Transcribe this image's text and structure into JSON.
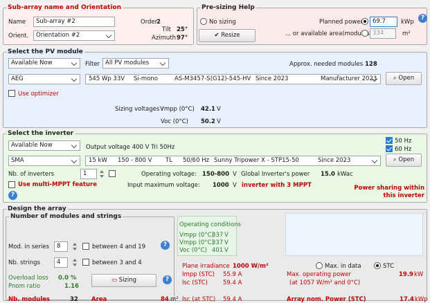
{
  "subarray": {
    "legend": "Sub-array name and Orientation",
    "name_label": "Name",
    "name_value": "Sub-array #2",
    "order_label": "Order",
    "order_value": "2",
    "orient_label": "Orient.",
    "orient_value": "Orientation #2",
    "tilt_label": "Tilt",
    "tilt_value": "25°",
    "azimuth_label": "Azimuth",
    "azimuth_value": "97°"
  },
  "presizing": {
    "legend": "Pre-sizing Help",
    "no_sizing": "No sizing",
    "planned_power_label": "Planned power",
    "planned_power_value": "69.7",
    "planned_power_unit": "kWp",
    "area_label": "... or available area(modules)",
    "area_value": "334",
    "area_unit": "m²",
    "resize_button": "Resize"
  },
  "pv_module": {
    "legend": "Select the PV module",
    "availability": "Available Now",
    "filter_label": "Filter",
    "filter_value": "All PV modules",
    "needed_label": "Approx. needed modules",
    "needed_value": "128",
    "manufacturer": "AEG",
    "model_row": [
      "545 Wp 33V",
      "Si-mono",
      "AS-M3457-S(G12)-545-HV",
      "Since 2023",
      "Manufacturer 2023"
    ],
    "open_button": "Open",
    "optimizer_label": "Use optimizer",
    "sizing_label": "Sizing voltages :",
    "vmpp_label": "Vmpp (0°C)",
    "vmpp_value": "42.1",
    "vmpp_unit": "V",
    "voc_label": "Voc (0°C)",
    "voc_value": "50.2",
    "voc_unit": "V"
  },
  "inverter": {
    "legend": "Select the inverter",
    "availability": "Available Now",
    "output_voltage": "Output voltage 400 V Tri 50Hz",
    "hz50": "50 Hz",
    "hz60": "60 Hz",
    "manufacturer": "SMA",
    "model_row": [
      "15 kW",
      "150 - 800 V",
      "TL",
      "50/60 Hz",
      "Sunny Tripower X - STP15-50",
      "Since 2023"
    ],
    "open_button": "Open",
    "nb_label": "Nb. of inverters",
    "nb_value": "1",
    "op_voltage_label": "Operating voltage:",
    "op_voltage_value": "150-800",
    "op_voltage_unit": "V",
    "global_power_label": "Global Inverter's power",
    "global_power_value": "15.0",
    "global_power_unit": "kWac",
    "multi_mppt_label": "Use multi-MPPT feature",
    "input_max_label": "Input maximum voltage:",
    "input_max_value": "1000",
    "input_max_unit": "V",
    "mppt_note": "inverter with 3 MPPT",
    "power_sharing_1": "Power sharing within",
    "power_sharing_2": "this inverter"
  },
  "design": {
    "legend": "Design the array",
    "sub_legend": "Number of modules and strings",
    "mod_series_label": "Mod. in series",
    "mod_series_value": "8",
    "mod_series_range": "between 4 and 19",
    "nb_strings_label": "Nb. strings",
    "nb_strings_value": "4",
    "nb_strings_range": "between 3 and 4",
    "overload_label": "Overload loss",
    "overload_value": "0.0 %",
    "pnom_label": "Pnom ratio",
    "pnom_value": "1.16",
    "sizing_button": "Sizing",
    "nb_modules_label": "Nb. modules",
    "nb_modules_value": "32",
    "area_label": "Area",
    "area_value": "84",
    "area_unit": "m²",
    "opcond_title": "Operating conditions",
    "opcond": [
      {
        "label": "Vmpp (0°C)",
        "value": "337",
        "unit": "V"
      },
      {
        "label": "Vmpp (0°C)",
        "value": "337",
        "unit": "V"
      },
      {
        "label": "Voc (0°C)",
        "value": "401",
        "unit": "V"
      }
    ],
    "irradiance_label": "Plane irradiance",
    "irradiance_value": "1000 W/m²",
    "max_in_data": "Max. in data",
    "stc": "STC",
    "impp_label": "Impp (STC)",
    "impp_value": "55.9 A",
    "isc_label": "Isc (STC)",
    "isc_value": "59.4 A",
    "max_op_power_label": "Max. operating power",
    "max_op_power_value": "19.9",
    "max_op_power_unit": "kW",
    "max_op_power_note": "(at 1057 W/m² and 0°C)",
    "isc_at_stc_label": "Isc (at STC)",
    "isc_at_stc_value": "59.4 A",
    "array_nom_label": "Array nom. Power (STC)",
    "array_nom_value": "17.4",
    "array_nom_unit": "kWp"
  },
  "colors": {
    "subarray_bg": "#fdf0ee",
    "presizing_bg": "#fdeaea",
    "pvmodule_bg": "#e8f0fb",
    "inverter_bg": "#eaf8e6",
    "accent": "#c00000",
    "selection": "#2a7bd4"
  }
}
